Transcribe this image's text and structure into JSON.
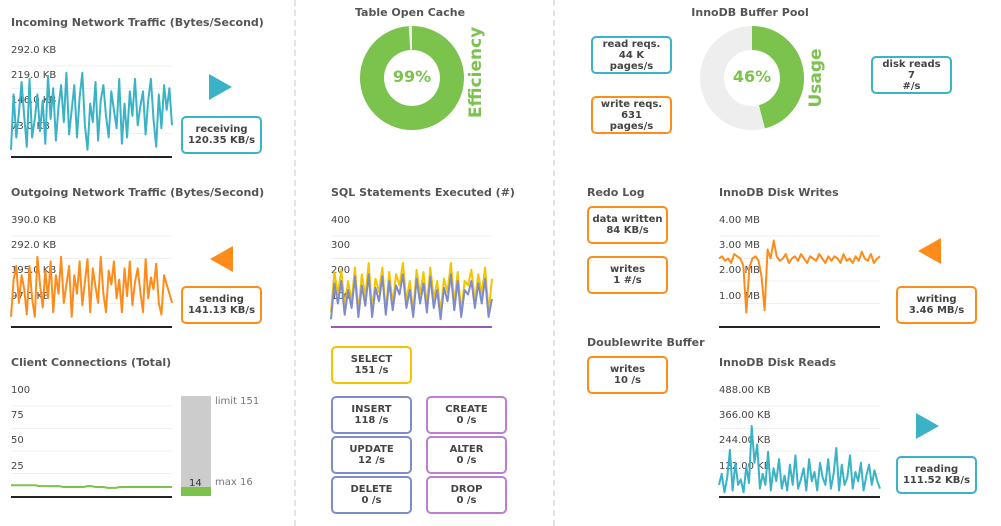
{
  "colors": {
    "teal": "#3ab3c6",
    "orange": "#ff8c1a",
    "green": "#7cc34e",
    "gray": "#cccccc",
    "yellow": "#f5c400",
    "blue": "#7f8ccc",
    "purple": "#bf7fd1"
  },
  "incoming": {
    "title": "Incoming Network Traffic (Bytes/Second)",
    "ticks": [
      "292.0 KB",
      "219.0 KB",
      "146.0 KB",
      "73.0 KB"
    ],
    "arrow_icon": "play-right-icon",
    "stat_label": "receiving",
    "stat_value": "120.35 KB/s"
  },
  "outgoing": {
    "title": "Outgoing Network Traffic (Bytes/Second)",
    "ticks": [
      "390.0 KB",
      "292.0 KB",
      "195.0 KB",
      "97.0 KB"
    ],
    "arrow_icon": "play-left-icon",
    "stat_label": "sending",
    "stat_value": "141.13 KB/s"
  },
  "connections": {
    "title": "Client Connections (Total)",
    "ticks": [
      "100",
      "75",
      "50",
      "25"
    ],
    "limit_label": "limit 151",
    "max_label": "max 16",
    "current": "14",
    "current_value": 14,
    "limit_value": 151
  },
  "table_cache": {
    "title": "Table Open Cache",
    "percent": "99%",
    "percent_value": 99,
    "side_label": "Efficiency"
  },
  "sql": {
    "title": "SQL Statements Executed (#)",
    "ticks": [
      "400",
      "300",
      "200",
      "100"
    ],
    "select_label": "SELECT",
    "select_value": "151 /s",
    "insert_label": "INSERT",
    "insert_value": "118 /s",
    "create_label": "CREATE",
    "create_value": "0 /s",
    "update_label": "UPDATE",
    "update_value": "12 /s",
    "alter_label": "ALTER",
    "alter_value": "0 /s",
    "delete_label": "DELETE",
    "delete_value": "0 /s",
    "drop_label": "DROP",
    "drop_value": "0 /s"
  },
  "buffer_pool": {
    "title": "InnoDB Buffer Pool",
    "read_label": "read reqs.",
    "read_value": "44 K",
    "read_unit": "pages/s",
    "write_label": "write reqs.",
    "write_value": "631",
    "write_unit": "pages/s",
    "percent": "46%",
    "percent_value": 46,
    "side_label": "Usage",
    "disk_label": "disk reads",
    "disk_value": "7",
    "disk_unit": "#/s"
  },
  "redo_log": {
    "title": "Redo Log",
    "written_label": "data written",
    "written_value": "84 KB/s",
    "writes_label": "writes",
    "writes_value": "1 #/s"
  },
  "doublewrite": {
    "title": "Doublewrite Buffer",
    "writes_label": "writes",
    "writes_value": "10 /s"
  },
  "disk_writes": {
    "title": "InnoDB Disk Writes",
    "ticks": [
      "4.00 MB",
      "3.00 MB",
      "2.00 MB",
      "1.00 MB"
    ],
    "arrow_icon": "play-left-icon",
    "stat_label": "writing",
    "stat_value": "3.46 MB/s"
  },
  "disk_reads": {
    "title": "InnoDB Disk Reads",
    "ticks": [
      "488.00 KB",
      "366.00 KB",
      "244.00 KB",
      "122.00 KB"
    ],
    "arrow_icon": "play-right-icon",
    "stat_label": "reading",
    "stat_value": "111.52 KB/s"
  },
  "chart_data": [
    {
      "type": "line",
      "title": "Incoming Network Traffic (Bytes/Second)",
      "ylim": [
        0,
        292
      ],
      "series": [
        {
          "values": [
            20,
            200,
            60,
            140,
            240,
            130,
            30,
            250,
            60,
            120,
            200,
            80,
            180,
            40,
            260,
            120,
            220,
            50,
            160,
            230,
            110,
            270,
            70,
            150,
            230,
            60,
            190,
            270,
            100,
            20,
            170,
            110,
            240,
            50,
            180,
            230,
            130,
            60,
            210,
            150,
            90,
            250,
            40,
            170,
            60,
            210,
            130,
            250,
            100,
            160,
            210,
            70,
            180,
            250,
            120,
            30,
            200,
            90,
            230,
            150,
            220,
            100
          ]
        }
      ]
    },
    {
      "type": "line",
      "title": "Outgoing Network Traffic (Bytes/Second)",
      "ylim": [
        0,
        390
      ],
      "series": [
        {
          "values": [
            40,
            200,
            260,
            100,
            220,
            160,
            50,
            260,
            120,
            40,
            300,
            180,
            80,
            240,
            120,
            280,
            60,
            220,
            140,
            300,
            100,
            180,
            260,
            40,
            220,
            140,
            280,
            90,
            190,
            290,
            60,
            250,
            170,
            100,
            300,
            140,
            60,
            240,
            180,
            280,
            120,
            200,
            60,
            250,
            130,
            280,
            90,
            190,
            250,
            150,
            60,
            290,
            120,
            210,
            160,
            270,
            100,
            50,
            220,
            180,
            140,
            100
          ]
        }
      ]
    },
    {
      "type": "line",
      "title": "Client Connections (Total)",
      "ylim": [
        0,
        100
      ],
      "series": [
        {
          "values": [
            12,
            12,
            12,
            12,
            12,
            12,
            12,
            11,
            11,
            11,
            11,
            11,
            11,
            10,
            10,
            10,
            10,
            10,
            10,
            11,
            11,
            10,
            10,
            10,
            9,
            9,
            9,
            10,
            10,
            10,
            10,
            10,
            10,
            10,
            10,
            10,
            10,
            10,
            10,
            10,
            10
          ]
        }
      ]
    },
    {
      "type": "line",
      "title": "SQL Statements Executed (#)",
      "ylim": [
        0,
        400
      ],
      "series": [
        {
          "name": "SELECT",
          "values": [
            60,
            240,
            140,
            250,
            80,
            200,
            110,
            260,
            60,
            230,
            130,
            280,
            70,
            210,
            150,
            260,
            60,
            240,
            100,
            230,
            180,
            280,
            110,
            200,
            60,
            250,
            140,
            240,
            90,
            260,
            120,
            200,
            60,
            210,
            150,
            280,
            100,
            240,
            60,
            200,
            180,
            250,
            110,
            230,
            140,
            260,
            60,
            210
          ]
        },
        {
          "name": "INSERT",
          "values": [
            30,
            190,
            100,
            200,
            50,
            160,
            80,
            220,
            40,
            180,
            90,
            230,
            40,
            170,
            110,
            220,
            50,
            200,
            70,
            180,
            140,
            230,
            80,
            160,
            40,
            210,
            100,
            190,
            60,
            220,
            80,
            160,
            30,
            170,
            110,
            230,
            70,
            200,
            40,
            160,
            140,
            200,
            80,
            190,
            100,
            210,
            40,
            120
          ]
        }
      ]
    },
    {
      "type": "line",
      "title": "InnoDB Disk Writes",
      "ylim": [
        0,
        4
      ],
      "series": [
        {
          "values": [
            3.0,
            3.1,
            2.9,
            3.0,
            2.8,
            3.2,
            3.1,
            3.0,
            2.7,
            0.6,
            2.6,
            3.0,
            3.1,
            2.9,
            2.2,
            0.7,
            3.4,
            3.0,
            3.8,
            3.1,
            2.9,
            3.0,
            3.2,
            2.8,
            3.0,
            3.1,
            2.9,
            3.2,
            3.0,
            2.8,
            3.1,
            3.0,
            2.9,
            3.2,
            3.0,
            2.8,
            3.1,
            2.9,
            3.1,
            3.0,
            2.8,
            3.2,
            2.9,
            3.0,
            2.8,
            3.1,
            2.9,
            3.3,
            3.0,
            2.9,
            3.2,
            2.8,
            3.0,
            3.1
          ]
        }
      ]
    },
    {
      "type": "line",
      "title": "InnoDB Disk Reads",
      "ylim": [
        0,
        488
      ],
      "series": [
        {
          "values": [
            60,
            120,
            20,
            100,
            250,
            30,
            180,
            60,
            90,
            20,
            160,
            70,
            380,
            180,
            280,
            40,
            120,
            60,
            240,
            30,
            150,
            80,
            200,
            40,
            110,
            30,
            170,
            60,
            220,
            40,
            90,
            150,
            30,
            200,
            80,
            130,
            30,
            180,
            100,
            60,
            200,
            40,
            120,
            260,
            30,
            170,
            60,
            100,
            220,
            40,
            130,
            80,
            180,
            30,
            110,
            170,
            60,
            140,
            80,
            40
          ]
        }
      ]
    },
    {
      "type": "pie",
      "title": "Table Open Cache",
      "values": [
        99,
        1
      ]
    },
    {
      "type": "pie",
      "title": "InnoDB Buffer Pool",
      "values": [
        46,
        54
      ]
    }
  ]
}
